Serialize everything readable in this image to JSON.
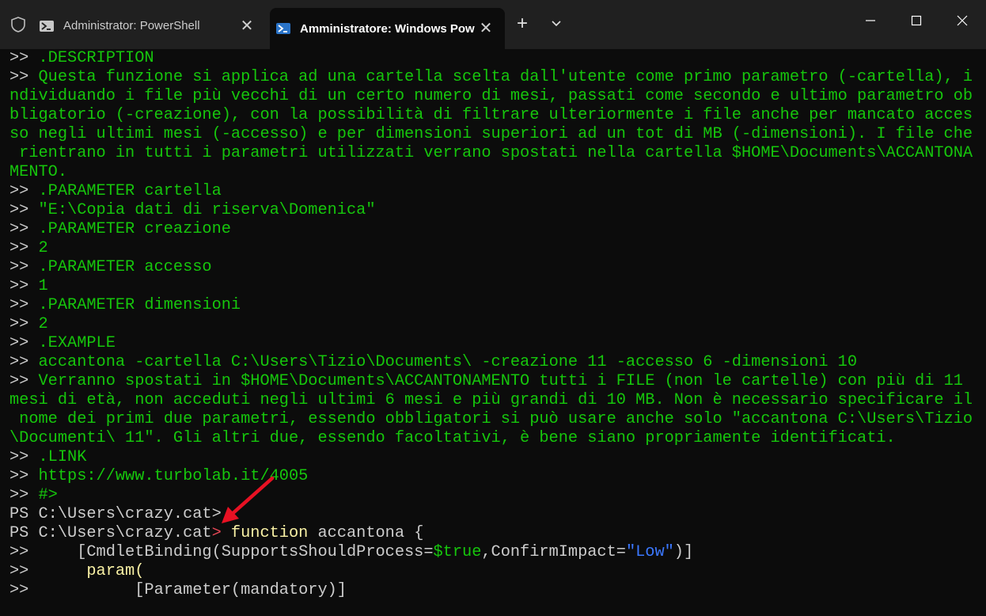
{
  "tabs": [
    {
      "label": "Administrator: PowerShell",
      "close": "✕"
    },
    {
      "label": "Amministratore: Windows PowerShell",
      "close": "✕"
    }
  ],
  "new_tab": "+",
  "lines": {
    "l1_p": ">>",
    "l1_t": " .DESCRIPTION",
    "l2_p": ">>",
    "l2_t": " Questa funzione si applica ad una cartella scelta dall'utente come primo parametro (-cartella), i",
    "l3": "ndividuando i file più vecchi di un certo numero di mesi, passati come secondo e ultimo parametro ob",
    "l4": "bligatorio (-creazione), con la possibilità di filtrare ulteriormente i file anche per mancato acces",
    "l5": "so negli ultimi mesi (-accesso) e per dimensioni superiori ad un tot di MB (-dimensioni). I file che",
    "l6": " rientrano in tutti i parametri utilizzati verrano spostati nella cartella $HOME\\Documents\\ACCANTONA",
    "l7": "MENTO.",
    "l8_p": ">>",
    "l8_t": " .PARAMETER cartella",
    "l9_p": ">>",
    "l9_t": " \"E:\\Copia dati di riserva\\Domenica\"",
    "l10_p": ">>",
    "l10_t": " .PARAMETER creazione",
    "l11_p": ">>",
    "l11_t": " 2",
    "l12_p": ">>",
    "l12_t": " .PARAMETER accesso",
    "l13_p": ">>",
    "l13_t": " 1",
    "l14_p": ">>",
    "l14_t": " .PARAMETER dimensioni",
    "l15_p": ">>",
    "l15_t": " 2",
    "l16_p": ">>",
    "l16_t": " .EXAMPLE",
    "l17_p": ">>",
    "l17_t": " accantona -cartella C:\\Users\\Tizio\\Documents\\ -creazione 11 -accesso 6 -dimensioni 10",
    "l18_p": ">>",
    "l18_t": " Verranno spostati in $HOME\\Documents\\ACCANTONAMENTO tutti i FILE (non le cartelle) con più di 11",
    "l19": "mesi di età, non acceduti negli ultimi 6 mesi e più grandi di 10 MB. Non è necessario specificare il",
    "l20": " nome dei primi due parametri, essendo obbligatori si può usare anche solo \"accantona C:\\Users\\Tizio",
    "l21": "\\Documenti\\ 11\". Gli altri due, essendo facoltativi, è bene siano propriamente identificati.",
    "l22_p": ">>",
    "l22_t": " .LINK",
    "l23_p": ">>",
    "l23_t": " https://www.turbolab.it/4005",
    "l24_p": ">>",
    "l24_t": " #>",
    "l25": "PS C:\\Users\\crazy.cat>",
    "l26_ps": "PS C:\\Users\\crazy.cat",
    "l26_gt": ">",
    "l26_fn": " function",
    "l26_rest": " accantona {",
    "l27_p": ">>",
    "l27_a": "     [CmdletBinding(SupportsShouldProcess=",
    "l27_true": "$true",
    "l27_comma": ",",
    "l27_b": "ConfirmImpact=",
    "l27_low": "\"Low\"",
    "l27_end": ")]",
    "l28_p": ">>",
    "l28_t": "      param(",
    "l29_p": ">>",
    "l29_t": "           [Parameter(mandatory)]"
  },
  "colors": {
    "green": "#16c60c",
    "white": "#cccccc",
    "yellow": "#f9f1a5",
    "blue": "#3b78ff",
    "red": "#e74856",
    "arrow": "#e81123"
  }
}
